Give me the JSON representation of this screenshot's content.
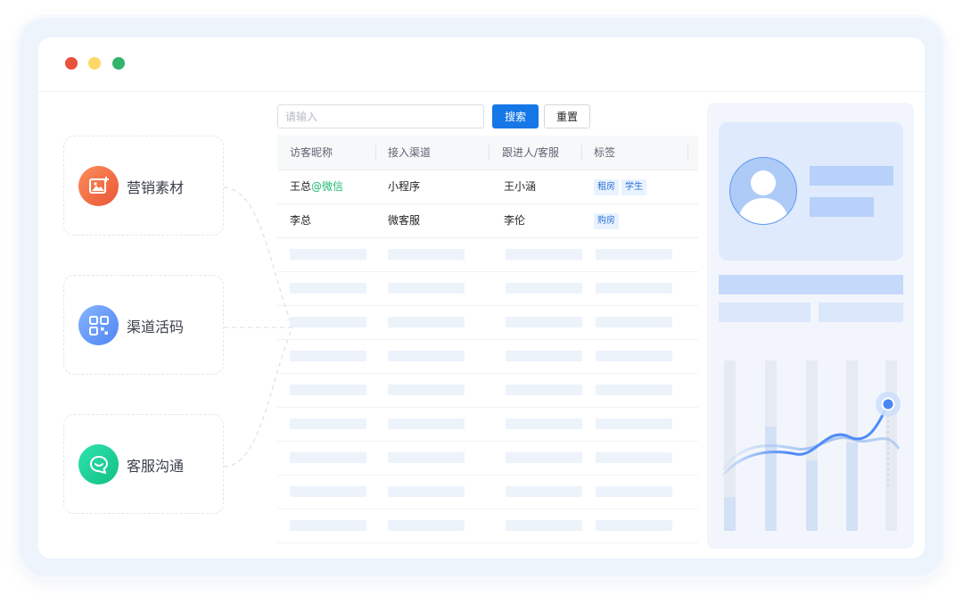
{
  "window": {
    "controls": [
      "close",
      "minimize",
      "maximize"
    ]
  },
  "features": [
    {
      "label": "营销素材",
      "icon": "image-plus-icon"
    },
    {
      "label": "渠道活码",
      "icon": "qr-code-icon"
    },
    {
      "label": "客服沟通",
      "icon": "chat-bubble-icon"
    }
  ],
  "search": {
    "placeholder": "请输入",
    "search_label": "搜索",
    "reset_label": "重置"
  },
  "table": {
    "headers": [
      "访客昵称",
      "接入渠道",
      "跟进人/客服",
      "标签"
    ],
    "rows": [
      {
        "name": "王总",
        "source": "@微信",
        "channel": "小程序",
        "agent": "王小涵",
        "tags": [
          "租房",
          "学生"
        ]
      },
      {
        "name": "李总",
        "source": "",
        "channel": "微客服",
        "agent": "李伦",
        "tags": [
          "购房"
        ]
      }
    ]
  },
  "colors": {
    "accent": "#1677e6",
    "wechat": "#1fba72",
    "dot_red": "#e9523b",
    "dot_yellow": "#fdd867",
    "dot_green": "#34b36b"
  }
}
